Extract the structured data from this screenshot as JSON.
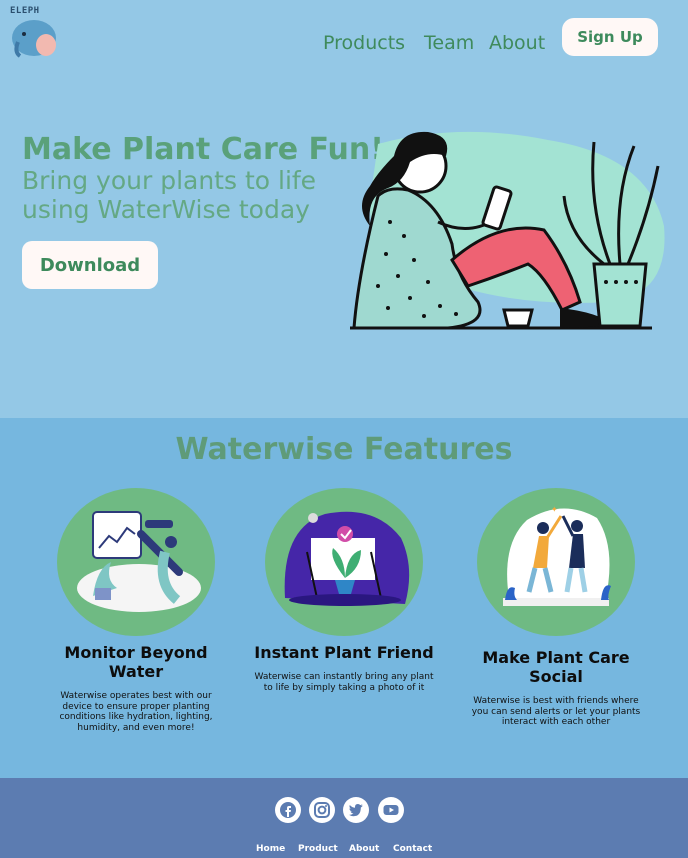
{
  "header": {
    "logo_text": "ELEPH",
    "nav": [
      {
        "label": "Products"
      },
      {
        "label": "Team"
      },
      {
        "label": "About"
      }
    ],
    "signup_label": "Sign Up"
  },
  "hero": {
    "headline": "Make Plant Care Fun!",
    "subline": "Bring your plants to life using WaterWise today",
    "download_label": "Download"
  },
  "features": {
    "title": "Waterwise Features",
    "cards": [
      {
        "title": "Monitor Beyond Water",
        "description": "Waterwise operates best with our device to ensure proper planting conditions like hydration, lighting, humidity, and even more!"
      },
      {
        "title": "Instant Plant Friend",
        "description": "Waterwise can instantly bring any plant to life by simply taking a photo of it"
      },
      {
        "title": "Make Plant Care Social",
        "description": "Waterwise is best with friends where you can send alerts or let your plants interact with each other"
      }
    ]
  },
  "footer": {
    "social_icons": [
      "facebook-icon",
      "instagram-icon",
      "twitter-icon",
      "youtube-icon"
    ],
    "links": [
      {
        "label": "Home"
      },
      {
        "label": "Product"
      },
      {
        "label": "About"
      },
      {
        "label": "Contact"
      }
    ]
  },
  "colors": {
    "hero_bg": "#94c8e6",
    "features_bg": "#76b7df",
    "footer_bg": "#5c7cb1",
    "accent_green": "#5aa17a",
    "circle_green": "#6fba83"
  }
}
